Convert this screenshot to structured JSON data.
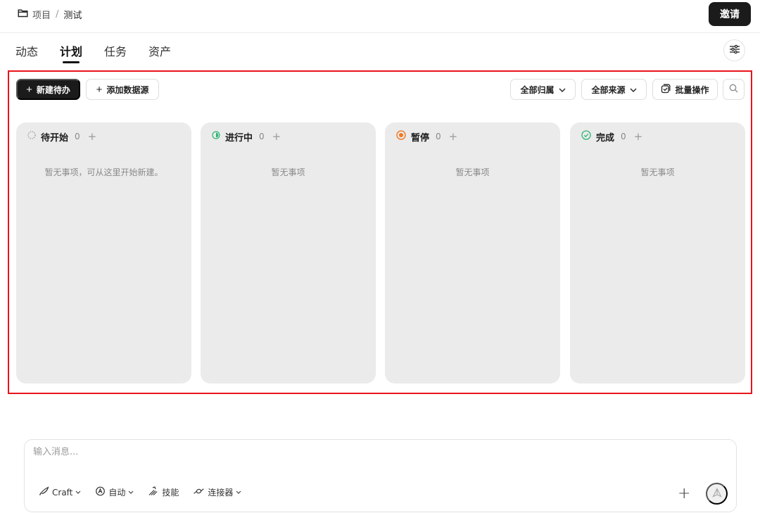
{
  "breadcrumb": {
    "root": "项目",
    "separator": "/",
    "current": "测试"
  },
  "header": {
    "invite_label": "邀请"
  },
  "tabs": [
    {
      "label": "动态",
      "active": false
    },
    {
      "label": "计划",
      "active": true
    },
    {
      "label": "任务",
      "active": false
    },
    {
      "label": "资产",
      "active": false
    }
  ],
  "toolbar": {
    "new_todo_label": "新建待办",
    "add_datasource_label": "添加数据源",
    "filter_owner_label": "全部归属",
    "filter_source_label": "全部来源",
    "bulk_label": "批量操作"
  },
  "columns": [
    {
      "title": "待开始",
      "count": "0",
      "empty_text": "暂无事项，可从这里开始新建。",
      "status_color": "#9a9a9a"
    },
    {
      "title": "进行中",
      "count": "0",
      "empty_text": "暂无事项",
      "status_color": "#2bb673"
    },
    {
      "title": "暂停",
      "count": "0",
      "empty_text": "暂无事项",
      "status_color": "#f07820"
    },
    {
      "title": "完成",
      "count": "0",
      "empty_text": "暂无事项",
      "status_color": "#2bb673"
    }
  ],
  "composer": {
    "placeholder": "输入消息...",
    "model_label": "Craft",
    "mode_label": "自动",
    "skills_label": "技能",
    "connector_label": "连接器"
  },
  "colors": {
    "accent": "#1b1b1b",
    "highlight_border": "#e8141b",
    "column_bg": "#ebebeb"
  }
}
